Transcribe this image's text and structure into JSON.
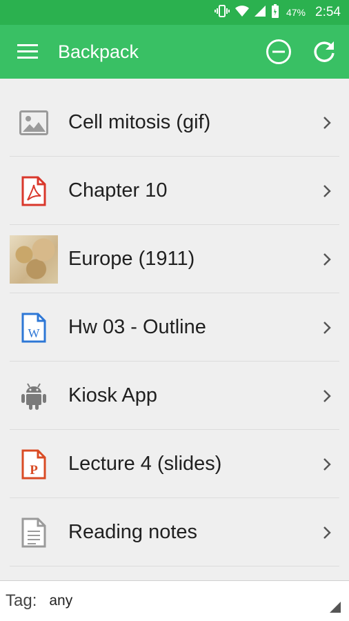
{
  "status_bar": {
    "battery_percent": "47%",
    "time": "2:54",
    "icons": [
      "vibrate-icon",
      "wifi-icon",
      "signal-icon",
      "battery-icon"
    ]
  },
  "app_bar": {
    "title": "Backpack",
    "icons": [
      "menu-icon",
      "remove-circle-icon",
      "refresh-icon"
    ]
  },
  "items": [
    {
      "label": "Cell mitosis (gif)",
      "icon": "image-icon"
    },
    {
      "label": "Chapter 10",
      "icon": "pdf-icon"
    },
    {
      "label": "Europe (1911)",
      "icon": "map-thumbnail"
    },
    {
      "label": "Hw 03 - Outline",
      "icon": "word-doc-icon"
    },
    {
      "label": "Kiosk App",
      "icon": "android-icon"
    },
    {
      "label": "Lecture 4 (slides)",
      "icon": "powerpoint-icon"
    },
    {
      "label": "Reading notes",
      "icon": "text-doc-icon"
    }
  ],
  "tag_filter": {
    "label": "Tag:",
    "value": "any"
  },
  "colors": {
    "status_bar": "#2bb14f",
    "app_bar": "#39c064",
    "pdf_red": "#d9372b",
    "word_blue": "#2d77d6",
    "ppt_orange": "#d94b24"
  }
}
